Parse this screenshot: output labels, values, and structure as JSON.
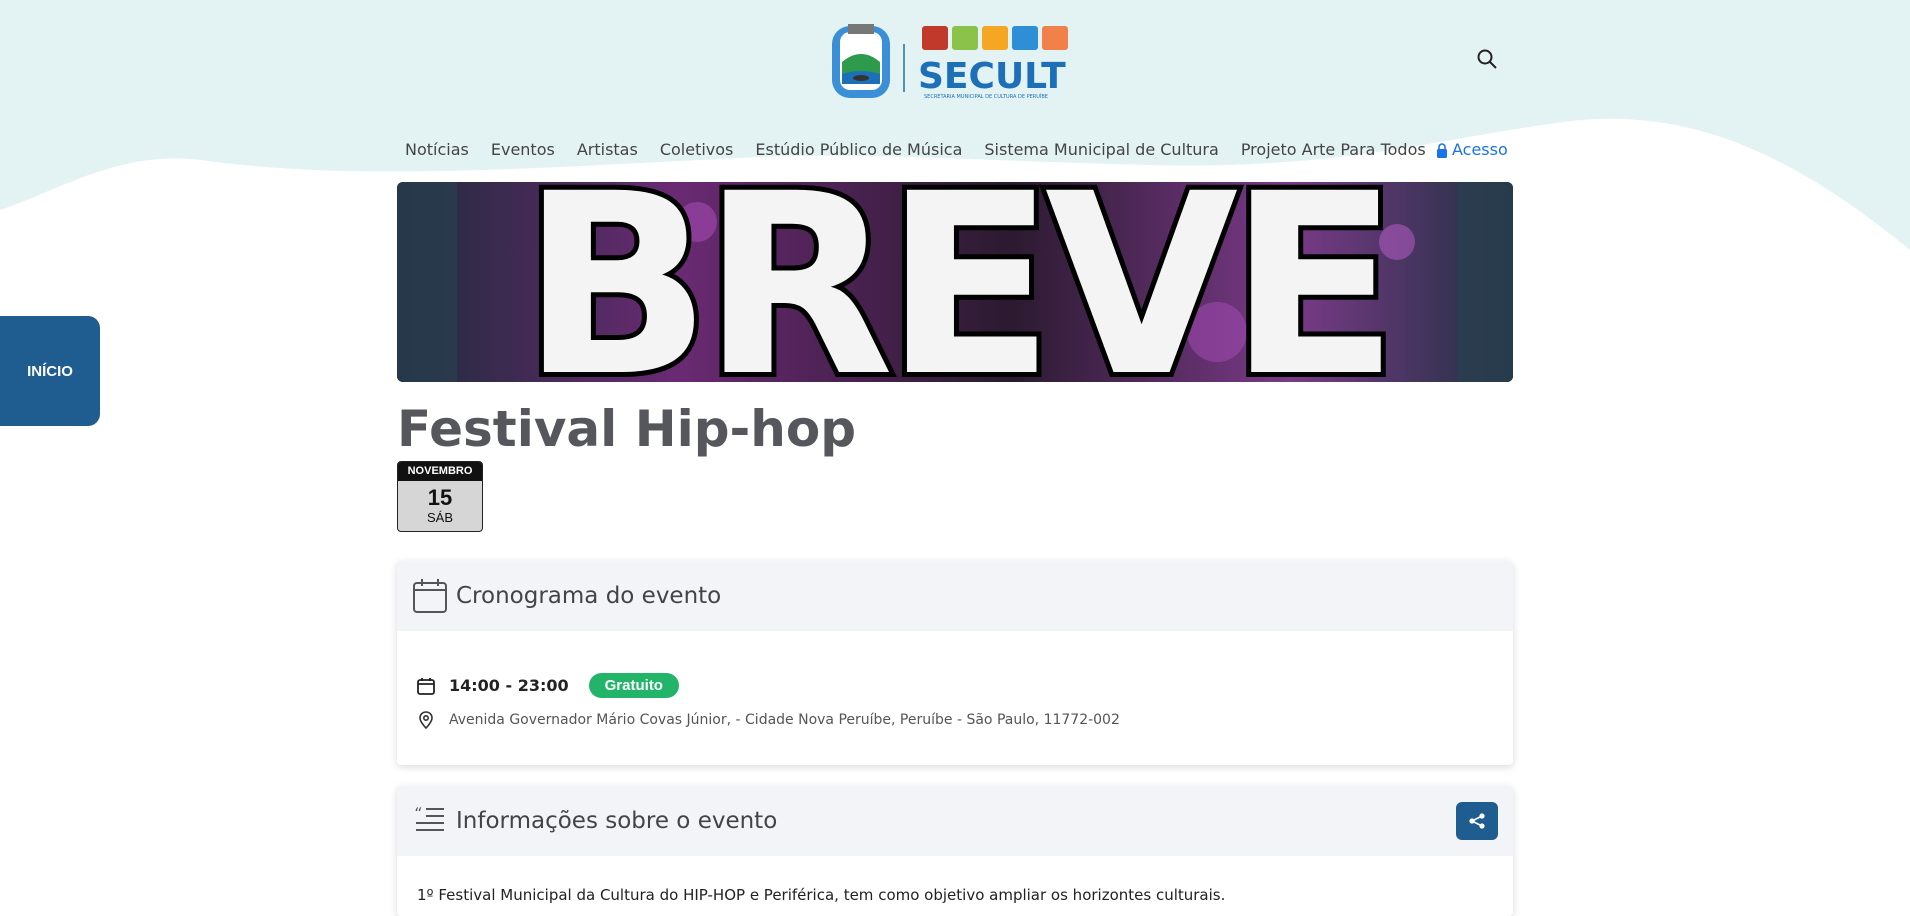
{
  "header": {
    "logo_text": "SECULT",
    "logo_subtitle": "SECRETARIA MUNICIPAL DE CULTURA DE PERUÍBE",
    "search_icon": "search-icon"
  },
  "nav": {
    "items": [
      {
        "label": "Notícias"
      },
      {
        "label": "Eventos"
      },
      {
        "label": "Artistas"
      },
      {
        "label": "Coletivos"
      },
      {
        "label": "Estúdio Público de Música"
      },
      {
        "label": "Sistema Municipal de Cultura"
      },
      {
        "label": "Projeto Arte Para Todos"
      }
    ],
    "acesso": "Acesso"
  },
  "side_tab": {
    "label": "INÍCIO"
  },
  "banner": {
    "text": "BREVE"
  },
  "event": {
    "title": "Festival Hip-hop",
    "date": {
      "month": "NOVEMBRO",
      "day": "15",
      "weekday": "SÁB"
    }
  },
  "schedule": {
    "heading": "Cronograma do evento",
    "time": "14:00 - 23:00",
    "price_badge": "Gratuito",
    "address": "Avenida Governador Mário Covas Júnior, - Cidade Nova Peruíbe, Peruíbe - São Paulo, 11772-002"
  },
  "info": {
    "heading": "Informações sobre o evento",
    "description": "1º Festival Municipal da Cultura do HIP-HOP e Periférica, tem como objetivo ampliar os horizontes culturais."
  },
  "colors": {
    "wave": "#e3f3f3",
    "primary": "#1f5c8f",
    "badge": "#22b56a",
    "link": "#1a73e8"
  }
}
